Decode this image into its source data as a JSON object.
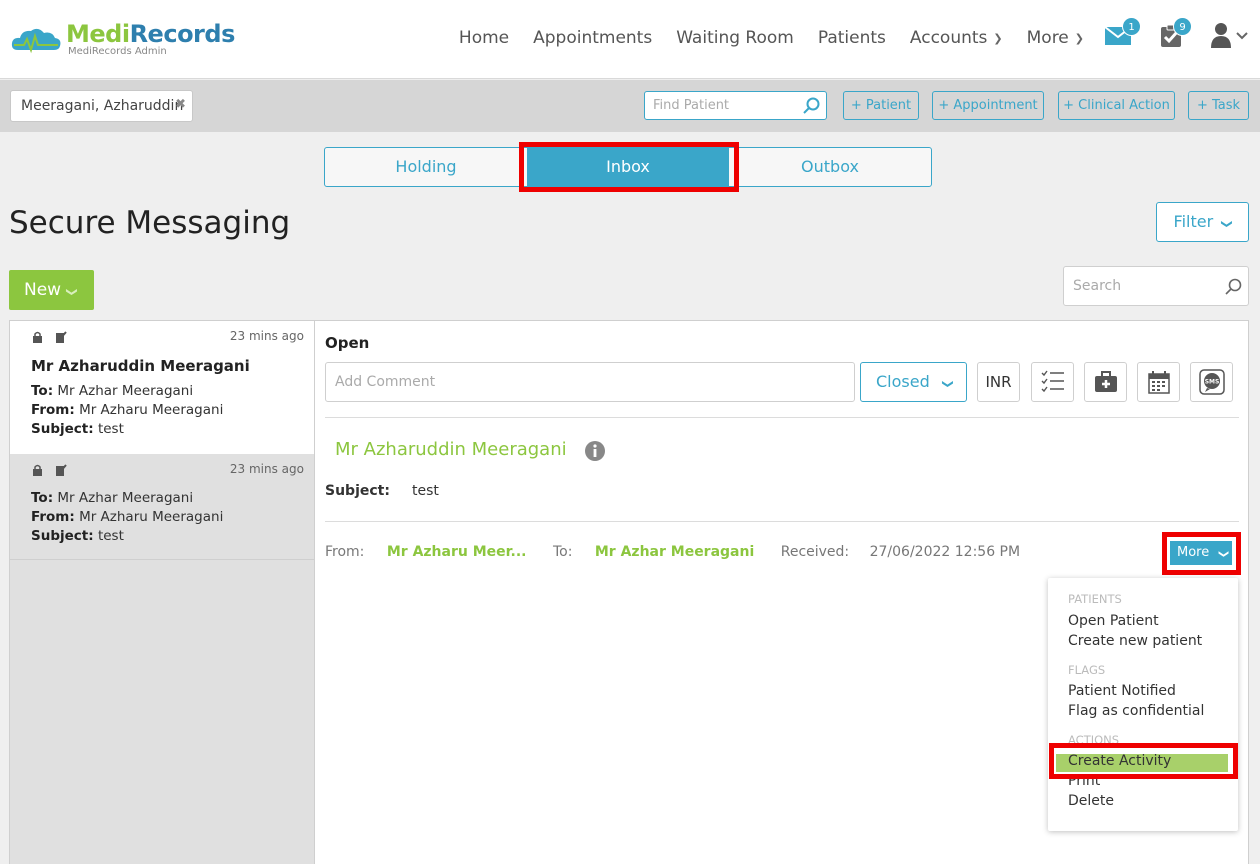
{
  "app": {
    "name_part1": "Medi",
    "name_part2": "Records",
    "subtitle": "MediRecords Admin"
  },
  "nav": {
    "items": [
      "Home",
      "Appointments",
      "Waiting Room",
      "Patients",
      "Accounts",
      "More"
    ],
    "mail_badge": "1",
    "tasks_badge": "9"
  },
  "patient_bar": {
    "current_patient": "Meeragani, Azharuddin",
    "find_placeholder": "Find Patient",
    "buttons": [
      "+ Patient",
      "+ Appointment",
      "+ Clinical Action",
      "+ Task"
    ]
  },
  "tabs": [
    "Holding",
    "Inbox",
    "Outbox"
  ],
  "active_tab": "Inbox",
  "page": {
    "title": "Secure Messaging",
    "filter_label": "Filter",
    "new_label": "New",
    "search_placeholder": "Search"
  },
  "messages": [
    {
      "time": "23 mins ago",
      "sender": "Mr Azharuddin Meeragani",
      "to": "Mr Azhar Meeragani",
      "from": "Mr Azharu Meeragani",
      "subject": "test",
      "selected": true
    },
    {
      "time": "23 mins ago",
      "sender": "",
      "to": "Mr Azhar Meeragani",
      "from": "Mr Azharu Meeragani",
      "subject": "test",
      "selected": false
    }
  ],
  "labels": {
    "to": "To:",
    "from": "From:",
    "subject": "Subject:"
  },
  "detail": {
    "status": "Open",
    "comment_placeholder": "Add Comment",
    "closed_label": "Closed",
    "inr_label": "INR",
    "patient_name": "Mr Azharuddin Meeragani",
    "subject_label": "Subject:",
    "subject_value": "test",
    "from_label": "From:",
    "from_value": "Mr Azharu Meer...",
    "to_label": "To:",
    "to_value": "Mr Azhar Meeragani",
    "received_label": "Received:",
    "received_value": "27/06/2022 12:56 PM",
    "more_label": "More"
  },
  "more_menu": {
    "patients_header": "PATIENTS",
    "open_patient": "Open Patient",
    "create_new_patient": "Create new patient",
    "flags_header": "FLAGS",
    "patient_notified": "Patient Notified",
    "flag_confidential": "Flag as confidential",
    "actions_header": "ACTIONS",
    "create_activity": "Create Activity",
    "print": "Print",
    "delete": "Delete"
  },
  "colors": {
    "accent": "#3aa6c9",
    "brand_green": "#8cc63f",
    "highlight": "#ee0000"
  }
}
